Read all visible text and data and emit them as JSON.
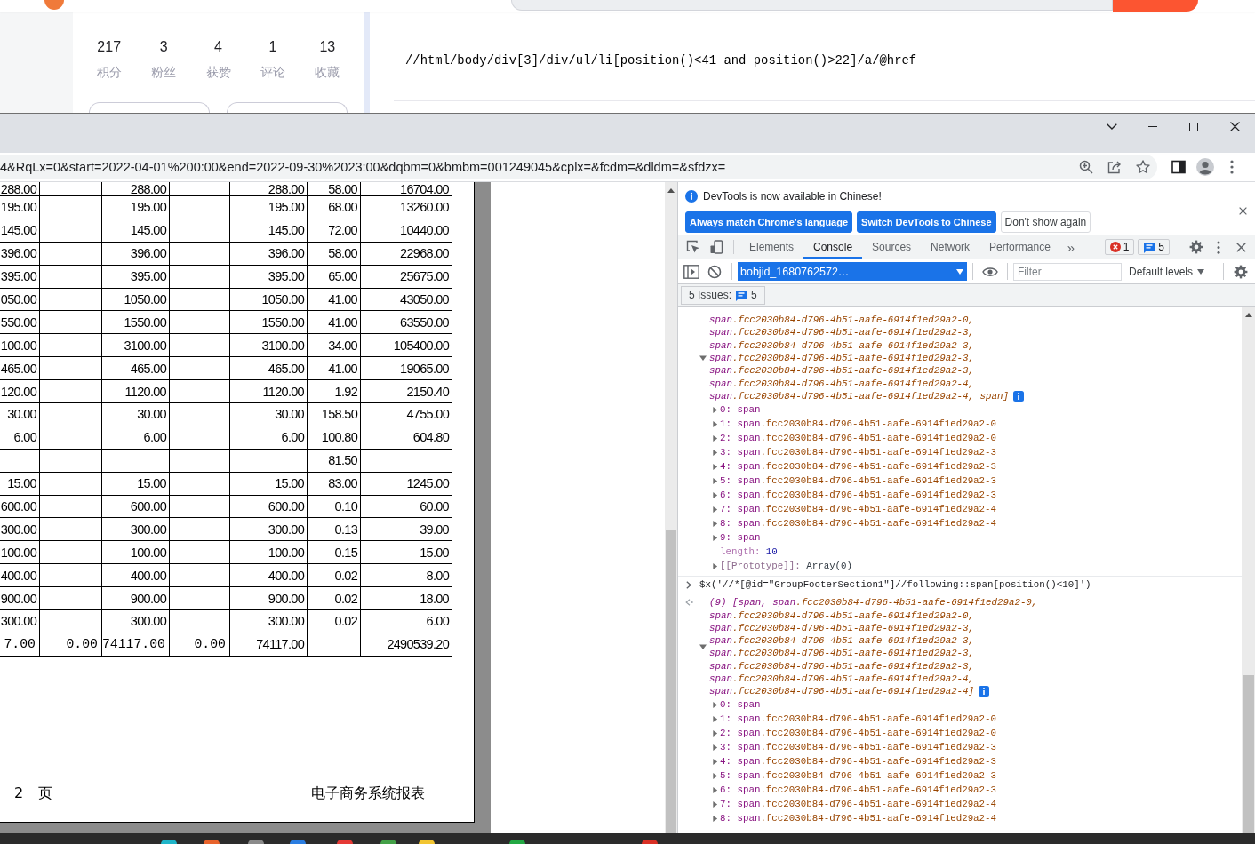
{
  "blog_page": {
    "profile_stats": [
      {
        "value": "217",
        "label": "积分"
      },
      {
        "value": "3",
        "label": "粉丝"
      },
      {
        "value": "4",
        "label": "获赞"
      },
      {
        "value": "1",
        "label": "评论"
      },
      {
        "value": "13",
        "label": "收藏"
      }
    ],
    "code_line": "//html/body/div[3]/div/ul/li[position()<41 and position()>22]/a/@href"
  },
  "browser": {
    "address": "4&RqLx=0&start=2022-04-01%200:00&end=2022-09-30%2023:00&dqbm=0&bmbm=001249045&cplx=&fcdm=&dldm=&sfdzx="
  },
  "report": {
    "rows": [
      {
        "kind": "data",
        "column_1": "288.00",
        "column_3": "288.00",
        "column_5": "288.00",
        "column_6": "58.00",
        "column_7": "16704.00"
      },
      {
        "kind": "data",
        "column_1": "195.00",
        "column_3": "195.00",
        "column_5": "195.00",
        "column_6": "68.00",
        "column_7": "13260.00"
      },
      {
        "kind": "data",
        "column_1": "145.00",
        "column_3": "145.00",
        "column_5": "145.00",
        "column_6": "72.00",
        "column_7": "10440.00"
      },
      {
        "kind": "data",
        "column_1": "396.00",
        "column_3": "396.00",
        "column_5": "396.00",
        "column_6": "58.00",
        "column_7": "22968.00"
      },
      {
        "kind": "data",
        "column_1": "395.00",
        "column_3": "395.00",
        "column_5": "395.00",
        "column_6": "65.00",
        "column_7": "25675.00"
      },
      {
        "kind": "data",
        "column_1": "050.00",
        "column_3": "1050.00",
        "column_5": "1050.00",
        "column_6": "41.00",
        "column_7": "43050.00"
      },
      {
        "kind": "data",
        "column_1": "550.00",
        "column_3": "1550.00",
        "column_5": "1550.00",
        "column_6": "41.00",
        "column_7": "63550.00"
      },
      {
        "kind": "data",
        "column_1": "100.00",
        "column_3": "3100.00",
        "column_5": "3100.00",
        "column_6": "34.00",
        "column_7": "105400.00"
      },
      {
        "kind": "data",
        "column_1": "465.00",
        "column_3": "465.00",
        "column_5": "465.00",
        "column_6": "41.00",
        "column_7": "19065.00"
      },
      {
        "kind": "data",
        "column_1": "120.00",
        "column_3": "1120.00",
        "column_5": "1120.00",
        "column_6": "1.92",
        "column_7": "2150.40"
      },
      {
        "kind": "data",
        "column_1": "30.00",
        "column_3": "30.00",
        "column_5": "30.00",
        "column_6": "158.50",
        "column_7": "4755.00"
      },
      {
        "kind": "data",
        "column_1": "6.00",
        "column_3": "6.00",
        "column_5": "6.00",
        "column_6": "100.80",
        "column_7": "604.80"
      },
      {
        "kind": "data",
        "column_6": "81.50"
      },
      {
        "kind": "data",
        "column_1": "15.00",
        "column_3": "15.00",
        "column_5": "15.00",
        "column_6": "83.00",
        "column_7": "1245.00"
      },
      {
        "kind": "data",
        "column_1": "600.00",
        "column_3": "600.00",
        "column_5": "600.00",
        "column_6": "0.10",
        "column_7": "60.00"
      },
      {
        "kind": "data",
        "column_1": "300.00",
        "column_3": "300.00",
        "column_5": "300.00",
        "column_6": "0.13",
        "column_7": "39.00"
      },
      {
        "kind": "data",
        "column_1": "100.00",
        "column_3": "100.00",
        "column_5": "100.00",
        "column_6": "0.15",
        "column_7": "15.00"
      },
      {
        "kind": "data",
        "column_1": "400.00",
        "column_3": "400.00",
        "column_5": "400.00",
        "column_6": "0.02",
        "column_7": "8.00"
      },
      {
        "kind": "data",
        "column_1": "900.00",
        "column_3": "900.00",
        "column_5": "900.00",
        "column_6": "0.02",
        "column_7": "18.00"
      },
      {
        "kind": "data",
        "column_1": "300.00",
        "column_3": "300.00",
        "column_5": "300.00",
        "column_6": "0.02",
        "column_7": "6.00"
      },
      {
        "kind": "total",
        "column_1": "7.00",
        "column_2": "0.00",
        "column_3": "74117.00",
        "column_4": "0.00",
        "column_5": "74117.00",
        "column_7": "2490539.20"
      }
    ],
    "footer": {
      "page_number": "2",
      "page_label": "页",
      "title": "电子商务系统报表"
    }
  },
  "devtools": {
    "infobar": {
      "message": "DevTools is now available in Chinese!",
      "buttons": [
        {
          "label": "Always match Chrome's language",
          "kind": "primary"
        },
        {
          "label": "Switch DevTools to Chinese",
          "kind": "primary"
        },
        {
          "label": "Don't show again",
          "kind": "secondary"
        }
      ]
    },
    "tabs": [
      {
        "label": "Elements",
        "selected": false
      },
      {
        "label": "Console",
        "selected": true
      },
      {
        "label": "Sources",
        "selected": false
      },
      {
        "label": "Network",
        "selected": false
      },
      {
        "label": "Performance",
        "selected": false
      }
    ],
    "more_tabs": "»",
    "error_count": "1",
    "message_count": "5",
    "context": "bobjid_1680762572…",
    "filter": {
      "placeholder": "Filter"
    },
    "levels": "Default levels",
    "issues": {
      "label": "5 Issues:",
      "count": "5"
    },
    "console": [
      {
        "kind": "continued",
        "expanded": true,
        "preview_lines": [
          "span.fcc2030b84-d796-4b51-aafe-6914f1ed29a2-0,",
          "span.fcc2030b84-d796-4b51-aafe-6914f1ed29a2-3,",
          "span.fcc2030b84-d796-4b51-aafe-6914f1ed29a2-3,",
          "span.fcc2030b84-d796-4b51-aafe-6914f1ed29a2-3,",
          "span.fcc2030b84-d796-4b51-aafe-6914f1ed29a2-3,",
          "span.fcc2030b84-d796-4b51-aafe-6914f1ed29a2-4,",
          "span.fcc2030b84-d796-4b51-aafe-6914f1ed29a2-4, span]"
        ],
        "children": [
          {
            "kind": "node",
            "key": "0:",
            "value": "span",
            "expanded": false
          },
          {
            "kind": "node",
            "key": "1:",
            "value": "span.fcc2030b84-d796-4b51-aafe-6914f1ed29a2-0",
            "expanded": false
          },
          {
            "kind": "node",
            "key": "2:",
            "value": "span.fcc2030b84-d796-4b51-aafe-6914f1ed29a2-0",
            "expanded": false
          },
          {
            "kind": "node",
            "key": "3:",
            "value": "span.fcc2030b84-d796-4b51-aafe-6914f1ed29a2-3",
            "expanded": false
          },
          {
            "kind": "node",
            "key": "4:",
            "value": "span.fcc2030b84-d796-4b51-aafe-6914f1ed29a2-3",
            "expanded": false
          },
          {
            "kind": "node",
            "key": "5:",
            "value": "span.fcc2030b84-d796-4b51-aafe-6914f1ed29a2-3",
            "expanded": false
          },
          {
            "kind": "node",
            "key": "6:",
            "value": "span.fcc2030b84-d796-4b51-aafe-6914f1ed29a2-3",
            "expanded": false
          },
          {
            "kind": "node",
            "key": "7:",
            "value": "span.fcc2030b84-d796-4b51-aafe-6914f1ed29a2-4",
            "expanded": false
          },
          {
            "kind": "node",
            "key": "8:",
            "value": "span.fcc2030b84-d796-4b51-aafe-6914f1ed29a2-4",
            "expanded": false
          },
          {
            "kind": "node",
            "key": "9:",
            "value": "span",
            "expanded": false
          },
          {
            "kind": "property",
            "key": "length:",
            "value": "10"
          },
          {
            "kind": "prototype",
            "key": "[[Prototype]]:",
            "value": "Array(0)",
            "expanded": false
          }
        ]
      },
      {
        "kind": "input",
        "text": "$x('//*[@id=\"GroupFooterSection1\"]//following::span[position()<10]')"
      },
      {
        "kind": "result",
        "expanded": true,
        "preview_lines": [
          "(9) [span, span.fcc2030b84-d796-4b51-aafe-6914f1ed29a2-0,",
          "span.fcc2030b84-d796-4b51-aafe-6914f1ed29a2-0,",
          "span.fcc2030b84-d796-4b51-aafe-6914f1ed29a2-3,",
          "span.fcc2030b84-d796-4b51-aafe-6914f1ed29a2-3,",
          "span.fcc2030b84-d796-4b51-aafe-6914f1ed29a2-3,",
          "span.fcc2030b84-d796-4b51-aafe-6914f1ed29a2-3,",
          "span.fcc2030b84-d796-4b51-aafe-6914f1ed29a2-4,",
          "span.fcc2030b84-d796-4b51-aafe-6914f1ed29a2-4]"
        ],
        "children": [
          {
            "kind": "node",
            "key": "0:",
            "value": "span",
            "expanded": false
          },
          {
            "kind": "node",
            "key": "1:",
            "value": "span.fcc2030b84-d796-4b51-aafe-6914f1ed29a2-0",
            "expanded": false
          },
          {
            "kind": "node",
            "key": "2:",
            "value": "span.fcc2030b84-d796-4b51-aafe-6914f1ed29a2-0",
            "expanded": false
          },
          {
            "kind": "node",
            "key": "3:",
            "value": "span.fcc2030b84-d796-4b51-aafe-6914f1ed29a2-3",
            "expanded": false
          },
          {
            "kind": "node",
            "key": "4:",
            "value": "span.fcc2030b84-d796-4b51-aafe-6914f1ed29a2-3",
            "expanded": false
          },
          {
            "kind": "node",
            "key": "5:",
            "value": "span.fcc2030b84-d796-4b51-aafe-6914f1ed29a2-3",
            "expanded": false
          },
          {
            "kind": "node",
            "key": "6:",
            "value": "span.fcc2030b84-d796-4b51-aafe-6914f1ed29a2-3",
            "expanded": false
          },
          {
            "kind": "node",
            "key": "7:",
            "value": "span.fcc2030b84-d796-4b51-aafe-6914f1ed29a2-4",
            "expanded": false
          },
          {
            "kind": "node",
            "key": "8:",
            "value": "span.fcc2030b84-d796-4b51-aafe-6914f1ed29a2-4",
            "expanded": false
          }
        ]
      }
    ]
  }
}
